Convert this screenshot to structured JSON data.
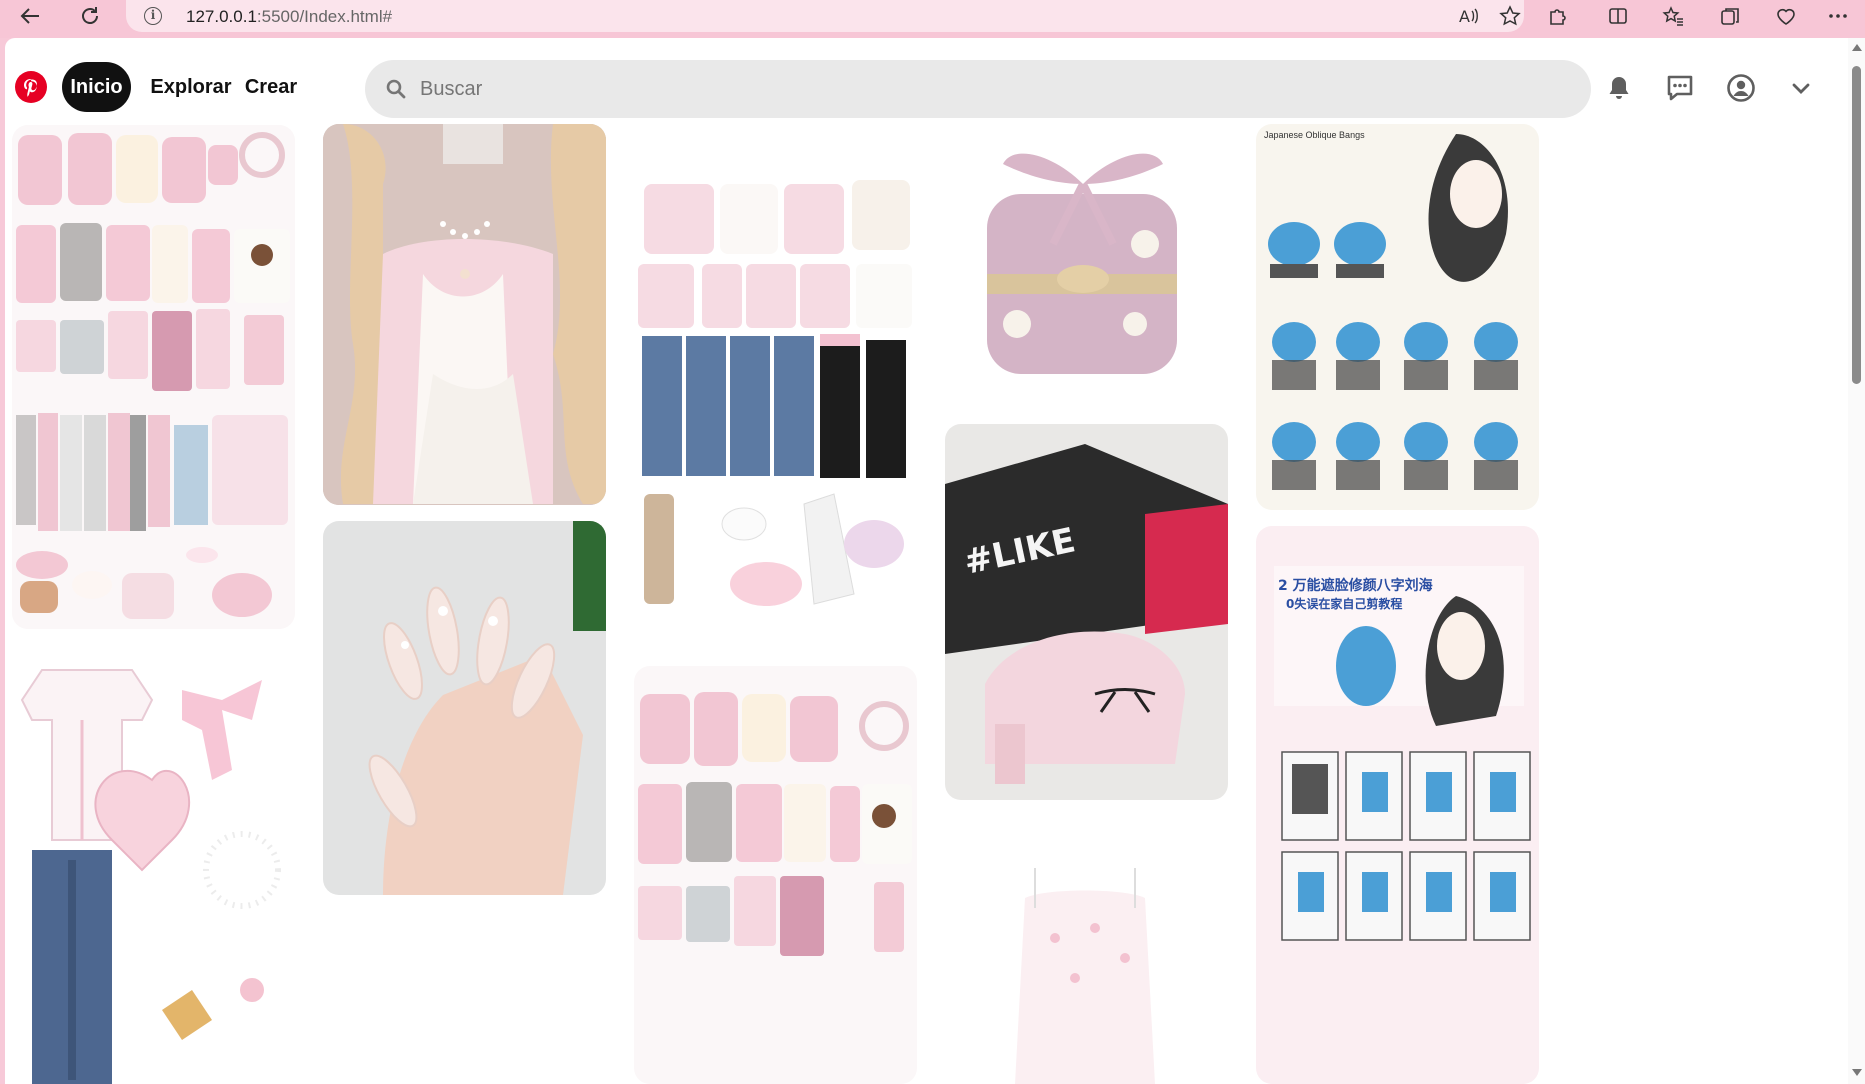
{
  "browser": {
    "url_host": "127.0.0.1",
    "url_rest": ":5500/Index.html#",
    "reader_label": "Ȃ"
  },
  "header": {
    "nav": [
      "Inicio",
      "Explorar",
      "Crear"
    ],
    "search_placeholder": "Buscar"
  },
  "pins": [
    {
      "topic": "pink-winter-clothing-flatlay"
    },
    {
      "topic": "pink-outfit-flatlay-with-heart-bag"
    },
    {
      "topic": "pink-cardigan-lace-dress"
    },
    {
      "topic": "pearl-nail-art"
    },
    {
      "topic": "pink-clothing-jeans-shoes-collage"
    },
    {
      "topic": "pink-clothing-collage"
    },
    {
      "topic": "pink-bow-jewelry-box"
    },
    {
      "topic": "pink-ballet-heels"
    },
    {
      "topic": "pink-corset-top"
    },
    {
      "topic": "japanese-bangs-tutorial",
      "title": "Japanese Oblique Bangs"
    },
    {
      "topic": "chinese-bangs-tutorial",
      "title": "2 万能遮脸修颜八字刘海",
      "subtitle": "0失误在家自己剪教程"
    }
  ]
}
